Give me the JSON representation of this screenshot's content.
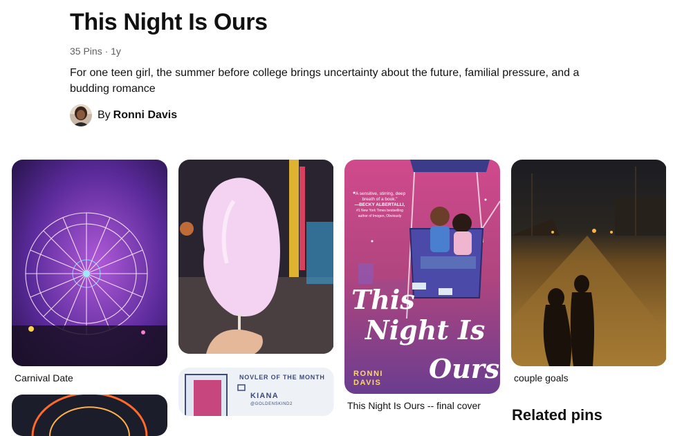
{
  "board": {
    "title": "This Night Is Ours",
    "meta": "35 Pins · 1y",
    "description": "For one teen girl, the summer before college brings uncertainty about the future, familial pressure, and a budding romance",
    "owner_prefix": "By",
    "owner_name": "Ronni Davis"
  },
  "pins": [
    {
      "caption": "Carnival Date",
      "image": "ferris-wheel-night-photo"
    },
    {
      "caption": "",
      "image": "cotton-candy-carnival-photo"
    },
    {
      "caption": "This Night Is Ours -- final cover",
      "image": "book-cover-illustration"
    },
    {
      "caption": "couple goals",
      "image": "couple-silhouette-street-photo"
    },
    {
      "caption": "",
      "image": "ferris-wheel-photo-partial"
    },
    {
      "caption": "",
      "image": "novler-of-the-month-graphic"
    }
  ],
  "cover": {
    "quote": "“A sensitive, stirring, deep breath of a book.”",
    "quote_author": "—BECKY ALBERTALLI,",
    "quote_credit_1": "#1 New York Times bestselling",
    "quote_credit_2": "author of Imogen, Obviously",
    "title_line1": "This",
    "title_line2": "Night Is",
    "title_line3": "Ours",
    "author_line1": "RONNI",
    "author_line2": "DAVIS"
  },
  "novler": {
    "heading": "NOVLER OF THE MONTH",
    "name": "KIANA",
    "handle": "@GOLDENSKIND2"
  },
  "section_partial": "Related pins",
  "colors": {
    "accent": "#111111",
    "meta": "#5f5f5f",
    "cover_pink": "#c83b7d",
    "cover_purple": "#6a3d8f"
  }
}
